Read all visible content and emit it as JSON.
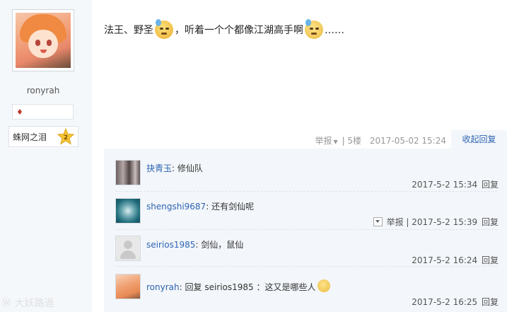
{
  "author": {
    "username": "ronyrah",
    "level_title": "蛛网之泪",
    "level_number": "2"
  },
  "post": {
    "text_part1": "法王、野圣",
    "text_part2": "，听着一个个都像江湖高手啊",
    "text_part3": "……",
    "emoji_1": "sweat-laugh-emoji",
    "emoji_2": "cold-sweat-emoji"
  },
  "post_meta": {
    "report_label": "举报",
    "floor": "5楼",
    "timestamp": "2017-05-02 15:24",
    "collapse_reply_label": "收起回复"
  },
  "comments": [
    {
      "user": "抉青玉",
      "sep": ":",
      "text": "修仙队",
      "time": "2017-5-2 15:34",
      "reply": "回复"
    },
    {
      "user": "shengshi9687",
      "sep": ":",
      "text": "还有剑仙呢",
      "report": "举报",
      "time": "2017-5-2 15:39",
      "reply": "回复"
    },
    {
      "user": "seirios1985",
      "sep": ":",
      "text": "剑仙，鼠仙",
      "time": "2017-5-2 16:24",
      "reply": "回复"
    },
    {
      "user": "ronyrah",
      "sep": ":",
      "text": "回复 seirios1985 ：这又是哪些人",
      "time": "2017-5-2 16:25",
      "reply": "回复"
    }
  ],
  "watermark": "大妖路過",
  "colors": {
    "link_blue": "#2d64b3",
    "comment_bg": "#f3f6fa",
    "sidebar_bg": "#f5f8fb"
  }
}
